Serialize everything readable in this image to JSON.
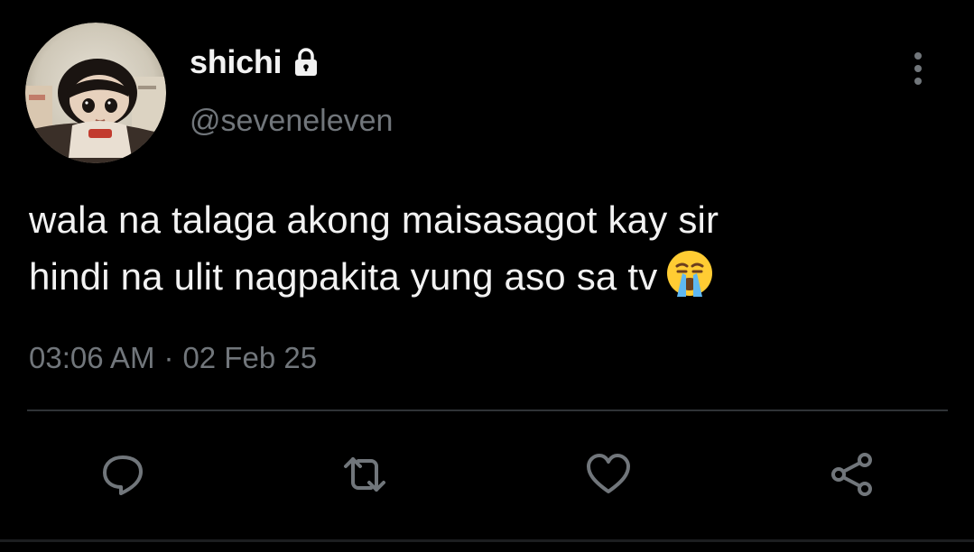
{
  "tweet": {
    "author": {
      "display_name": "shichi",
      "handle": "@seveneleven",
      "protected_icon": "lock-icon",
      "avatar_icon": "avatar-photo"
    },
    "text_lines": [
      "wala na talaga akong maisasagot kay sir",
      "hindi na ulit nagpakita yung aso sa tv"
    ],
    "emoji": "loudly-crying-face",
    "time": "03:06 AM",
    "separator": "·",
    "date": "02 Feb 25"
  },
  "actions": [
    {
      "name": "reply",
      "icon": "reply-icon"
    },
    {
      "name": "retweet",
      "icon": "retweet-icon"
    },
    {
      "name": "like",
      "icon": "heart-icon"
    },
    {
      "name": "share",
      "icon": "share-icon"
    }
  ],
  "colors": {
    "background": "#000000",
    "text": "#f2f2f2",
    "secondary": "#71767b",
    "divider": "#2f3336",
    "icon": "#71767b"
  }
}
